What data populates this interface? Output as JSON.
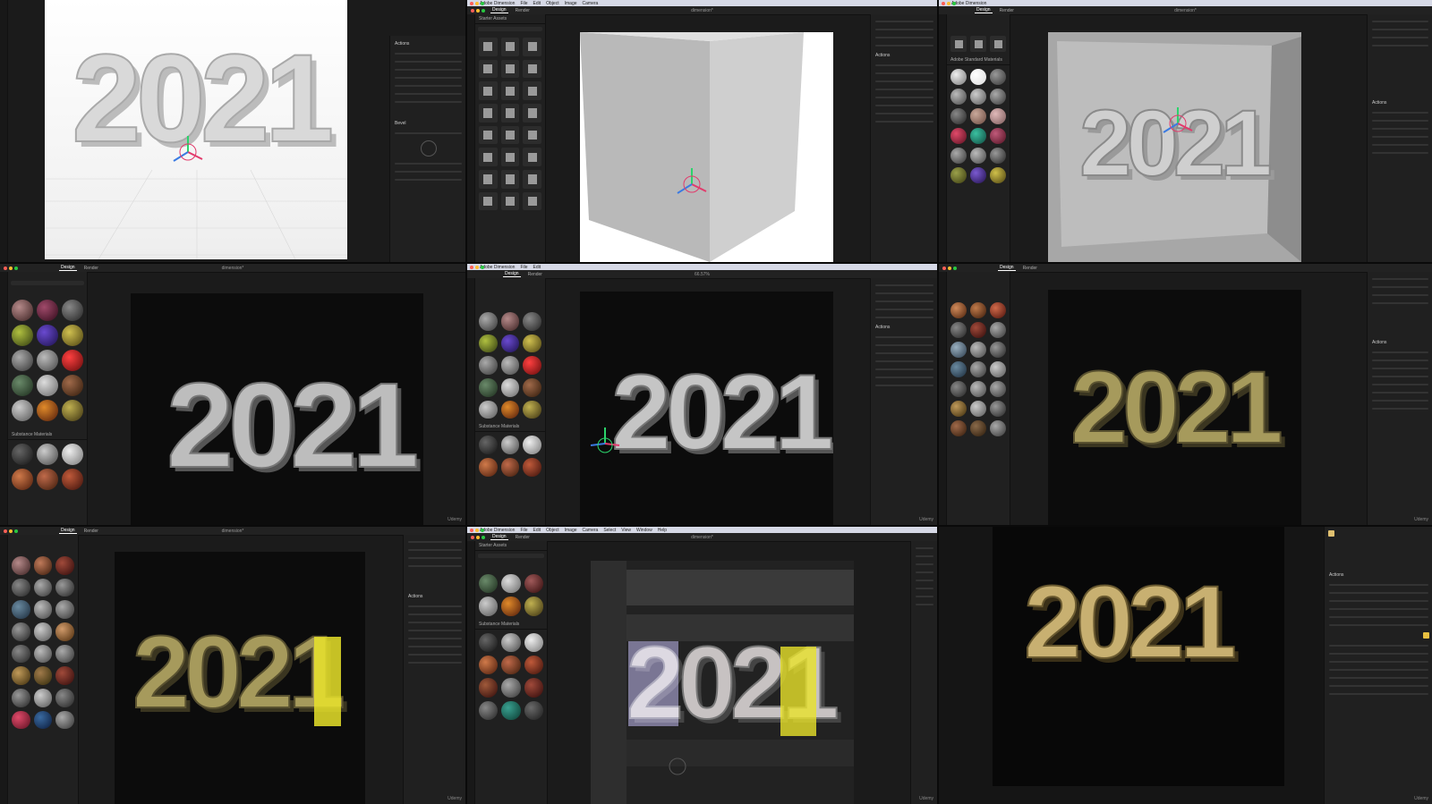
{
  "menubar": {
    "app": "Adobe Dimension",
    "menu_items": [
      "File",
      "Edit",
      "Object",
      "Image",
      "Camera",
      "Select",
      "View",
      "Window",
      "Help"
    ]
  },
  "tabs": {
    "design": "Design",
    "render": "Render"
  },
  "document_title": "dimension*",
  "zoom": "66.57%",
  "panels": {
    "actions": "Actions",
    "bevel": "Bevel",
    "substance_materials": "Substance Materials",
    "adobe_standard_materials": "Adobe Standard Materials",
    "starter_assets": "Starter Assets"
  },
  "scene_text": "2021",
  "colors": {
    "accent_yellow": "#e8e22a",
    "lavender": "#b9b1f0",
    "gold": "#b8a66a",
    "canvas_dark": "#0c0c0c"
  }
}
